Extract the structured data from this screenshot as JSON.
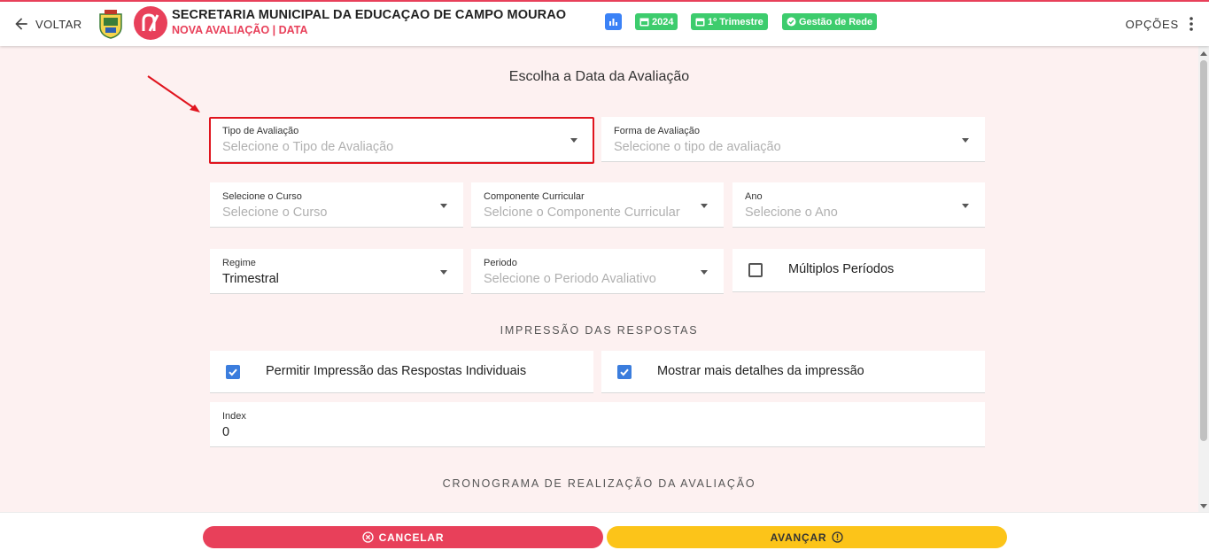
{
  "header": {
    "back_label": "VOLTAR",
    "title": "SECRETARIA MUNICIPAL DA EDUCAÇAO DE CAMPO MOURAO",
    "subtitle": "NOVA AVALIAÇÃO | DATA",
    "chips": [
      {
        "label": "2024",
        "icon": "calendar-icon"
      },
      {
        "label": "1º Trimestre",
        "icon": "calendar-icon"
      },
      {
        "label": "Gestão de Rede",
        "icon": "check-circle-icon"
      }
    ],
    "options_label": "OPÇÕES"
  },
  "page": {
    "heading": "Escolha a Data da Avaliação"
  },
  "form": {
    "tipo": {
      "label": "Tipo de Avaliação",
      "placeholder": "Selecione o Tipo de Avaliação"
    },
    "forma": {
      "label": "Forma de Avaliação",
      "placeholder": "Selecione o tipo de avaliação"
    },
    "curso": {
      "label": "Selecione o Curso",
      "placeholder": "Selecione o Curso"
    },
    "componente": {
      "label": "Componente Curricular",
      "placeholder": "Selcione o Componente Curricular"
    },
    "ano": {
      "label": "Ano",
      "placeholder": "Selecione o Ano"
    },
    "regime": {
      "label": "Regime",
      "value": "Trimestral"
    },
    "periodo": {
      "label": "Periodo",
      "placeholder": "Selecione o Periodo Avaliativo"
    },
    "multiplos": {
      "label": "Múltiplos Períodos",
      "checked": false
    }
  },
  "impressao": {
    "caption": "IMPRESSÃO DAS RESPOSTAS",
    "individuais": {
      "label": "Permitir Impressão das Respostas Individuais",
      "checked": true
    },
    "detalhes": {
      "label": "Mostrar mais detalhes da impressão",
      "checked": true
    }
  },
  "index": {
    "label": "Index",
    "value": "0"
  },
  "cronograma": {
    "caption": "CRONOGRAMA DE REALIZAÇÃO DA AVALIAÇÃO"
  },
  "footer": {
    "cancel_label": "CANCELAR",
    "next_label": "AVANÇAR"
  },
  "colors": {
    "brand": "#e8405a",
    "success": "#3dcc6d",
    "accent": "#3b7ddd",
    "warning": "#fcc419",
    "background": "#fdf1f1"
  }
}
